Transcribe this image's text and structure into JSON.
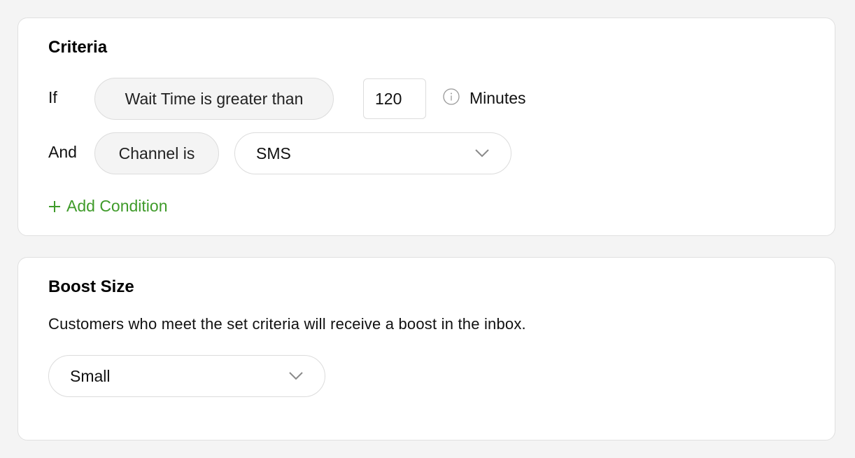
{
  "criteria": {
    "title": "Criteria",
    "conditions": [
      {
        "connector": "If",
        "field": "Wait Time is greater than",
        "value": "120",
        "units": "Minutes",
        "info_icon": "info-icon"
      },
      {
        "connector": "And",
        "field": "Channel is",
        "selected": "SMS",
        "dropdown_icon": "chevron-down-icon"
      }
    ],
    "add_condition": {
      "icon": "plus-icon",
      "label": "Add Condition"
    }
  },
  "boost": {
    "title": "Boost Size",
    "description": "Customers who meet the set criteria will receive a boost in the inbox.",
    "selected": "Small",
    "dropdown_icon": "chevron-down-icon"
  },
  "colors": {
    "accent": "#3f9b2a",
    "background": "#f4f4f4",
    "card": "#ffffff",
    "border": "#dcdcdc"
  }
}
